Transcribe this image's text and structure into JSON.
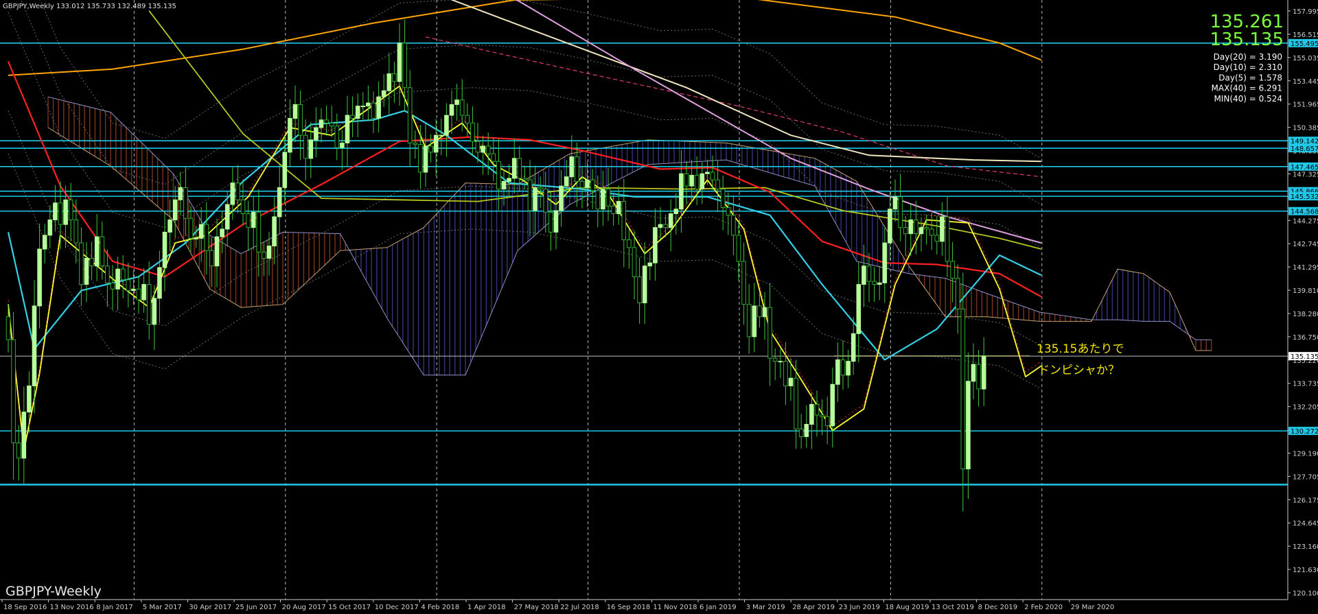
{
  "window": {
    "header": "GBPJPY,Weekly  133.012 135.733 132.489 135.135",
    "watermark": "GBPJPY-Weekly"
  },
  "price_box": {
    "bid": "135.261",
    "ask": "135.135",
    "stats": [
      "Day(20) = 3.190",
      "Day(10) = 2.310",
      "Day(5) = 1.578",
      "MAX(40) = 6.291",
      "MIN(40) = 0.524"
    ]
  },
  "annotation": {
    "line1": "135.15あたりで",
    "line2": "ドンピシャか？"
  },
  "colors": {
    "bull": "#b7ff9a",
    "bear": "#2fae2f",
    "hline": "#1ec8e6",
    "ma_fast": "#ffff33",
    "ma_mid": "#ff2020",
    "ma_cyan": "#33d0e8",
    "ma_long": "#ffa500",
    "ma_white": "#f0e6c0",
    "ma_violet": "#e0a0e0",
    "cloud_bull": "#8a3a20",
    "cloud_bear": "#3a3a8a"
  },
  "chart_data": {
    "type": "candlestick",
    "symbol": "GBPJPY",
    "timeframe": "Weekly",
    "ylim": [
      119.3,
      158.3
    ],
    "y_ticks": [
      "157.995",
      "156.515",
      "155.035",
      "153.445",
      "151.965",
      "150.385",
      "148.855",
      "147.325",
      "145.805",
      "144.275",
      "142.745",
      "141.295",
      "139.810",
      "138.280",
      "136.750",
      "135.220",
      "133.735",
      "132.205",
      "130.735",
      "129.190",
      "127.705",
      "126.175",
      "124.645",
      "123.160",
      "121.630",
      "120.100"
    ],
    "x_labels": [
      "18 Sep 2016",
      "13 Nov 2016",
      "8 Jan 2017",
      "5 Mar 2017",
      "30 Apr 2017",
      "25 Jun 2017",
      "20 Aug 2017",
      "15 Oct 2017",
      "10 Dec 2017",
      "4 Feb 2018",
      "1 Apr 2018",
      "27 May 2018",
      "22 Jul 2018",
      "16 Sep 2018",
      "11 Nov 2018",
      "6 Jan 2019",
      "3 Mar 2019",
      "28 Apr 2019",
      "23 Jun 2019",
      "18 Aug 2019",
      "13 Oct 2019",
      "8 Dec 2019",
      "2 Feb 2020",
      "29 Mar 2020"
    ],
    "hlines": [
      {
        "price": 155.495,
        "label": "155.495"
      },
      {
        "price": 149.142,
        "label": "149.142"
      },
      {
        "price": 148.657,
        "label": "148.657"
      },
      {
        "price": 147.465,
        "label": "147.465"
      },
      {
        "price": 145.866,
        "label": "145.866"
      },
      {
        "price": 145.532,
        "label": "145.532"
      },
      {
        "price": 144.568,
        "label": "144.568"
      },
      {
        "price": 130.272,
        "label": "130.272"
      },
      {
        "price": 126.78,
        "label": ""
      }
    ],
    "current_price": {
      "price": 135.135,
      "label": "135.135"
    },
    "closes": [
      136.2,
      129.5,
      128.5,
      131.5,
      133.2,
      138.4,
      142.1,
      143.0,
      144.0,
      145.1,
      143.7,
      145.3,
      144.0,
      142.5,
      139.8,
      141.5,
      141.0,
      142.9,
      141.0,
      139.9,
      139.5,
      140.8,
      140.1,
      139.4,
      139.5,
      138.8,
      139.8,
      137.2,
      138.9,
      140.9,
      143.2,
      144.0,
      145.3,
      146.1,
      144.1,
      142.8,
      142.8,
      143.7,
      142.0,
      141.0,
      142.9,
      143.4,
      145.0,
      146.4,
      145.3,
      144.4,
      143.5,
      144.5,
      141.9,
      141.5,
      142.3,
      144.2,
      146.1,
      148.4,
      150.6,
      151.5,
      149.5,
      148.0,
      149.2,
      150.0,
      150.5,
      150.3,
      150.1,
      148.7,
      149.0,
      150.8,
      150.6,
      151.4,
      151.4,
      151.6,
      150.6,
      152.0,
      152.4,
      153.5,
      153.0,
      155.5,
      152.6,
      149.0,
      148.9,
      147.1,
      148.8,
      148.4,
      149.5,
      149.5,
      150.8,
      151.5,
      151.8,
      150.8,
      150.3,
      149.1,
      148.4,
      148.8,
      148.3,
      147.8,
      146.0,
      146.5,
      146.7,
      148.0,
      146.7,
      146.6,
      144.6,
      146.1,
      146.0,
      144.5,
      143.2,
      144.6,
      146.2,
      146.8,
      148.1,
      146.5,
      146.1,
      146.6,
      145.9,
      144.7,
      146.0,
      144.9,
      144.4,
      145.2,
      142.7,
      142.2,
      140.3,
      138.6,
      141.0,
      141.2,
      143.5,
      143.7,
      143.5,
      144.4,
      144.7,
      147.0,
      146.2,
      146.9,
      146.0,
      147.0,
      147.1,
      146.6,
      146.0,
      144.8,
      144.3,
      143.0,
      141.3,
      138.5,
      136.4,
      138.4,
      137.7,
      138.3,
      135.0,
      134.8,
      134.8,
      133.2,
      133.7,
      130.4,
      129.9,
      130.7,
      132.0,
      131.3,
      131.2,
      130.6,
      133.3,
      134.9,
      133.9,
      134.8,
      136.6,
      139.8,
      141.0,
      140.0,
      139.8,
      139.9,
      142.5,
      144.7,
      145.5,
      143.5,
      143.1,
      144.0,
      143.1,
      143.5,
      143.4,
      143.0,
      142.6,
      144.2,
      141.3,
      140.2,
      138.2,
      127.8,
      133.5,
      134.6,
      133.0,
      135.135
    ],
    "ma_fast": [
      [
        0,
        138.5
      ],
      [
        3,
        129.0
      ],
      [
        6,
        134
      ],
      [
        10,
        143
      ],
      [
        16,
        141.3
      ],
      [
        22,
        139.6
      ],
      [
        27,
        138.3
      ],
      [
        32,
        142.5
      ],
      [
        38,
        143.0
      ],
      [
        46,
        145.5
      ],
      [
        54,
        150.0
      ],
      [
        62,
        149.5
      ],
      [
        75,
        152.7
      ],
      [
        80,
        148.7
      ],
      [
        87,
        150.3
      ],
      [
        93,
        147.6
      ],
      [
        99,
        146.5
      ],
      [
        105,
        145.0
      ],
      [
        110,
        146.8
      ],
      [
        115,
        145.7
      ],
      [
        122,
        141.8
      ],
      [
        127,
        143.3
      ],
      [
        134,
        146.6
      ],
      [
        141,
        143.4
      ],
      [
        146,
        136.8
      ],
      [
        152,
        133.6
      ],
      [
        158,
        130.3
      ],
      [
        164,
        131.7
      ],
      [
        170,
        139.8
      ],
      [
        176,
        144.0
      ],
      [
        184,
        143.8
      ],
      [
        190,
        139.5
      ],
      [
        195,
        133.8
      ],
      [
        198,
        134.5
      ]
    ],
    "ma_cyan": [
      [
        0,
        143.2
      ],
      [
        5,
        135.6
      ],
      [
        14,
        139.4
      ],
      [
        25,
        140.3
      ],
      [
        34,
        142.5
      ],
      [
        45,
        146.5
      ],
      [
        58,
        150.2
      ],
      [
        70,
        150.5
      ],
      [
        76,
        151.1
      ],
      [
        84,
        149.5
      ],
      [
        96,
        146.4
      ],
      [
        110,
        146.0
      ],
      [
        120,
        145.5
      ],
      [
        134,
        145.5
      ],
      [
        146,
        144.3
      ],
      [
        156,
        139.8
      ],
      [
        168,
        134.9
      ],
      [
        178,
        136.9
      ],
      [
        190,
        141.7
      ],
      [
        198,
        140.4
      ]
    ],
    "ma_mid": [
      [
        0,
        154.3
      ],
      [
        10,
        146.2
      ],
      [
        20,
        141.3
      ],
      [
        30,
        140.3
      ],
      [
        45,
        143.7
      ],
      [
        60,
        146.3
      ],
      [
        75,
        149.1
      ],
      [
        89,
        149.4
      ],
      [
        100,
        149.2
      ],
      [
        110,
        148.5
      ],
      [
        125,
        147.3
      ],
      [
        135,
        147.4
      ],
      [
        146,
        145.8
      ],
      [
        156,
        142.6
      ],
      [
        168,
        141.2
      ],
      [
        178,
        141.1
      ],
      [
        190,
        140.5
      ],
      [
        198,
        139.0
      ]
    ],
    "ma_olive": [
      [
        27,
        157.6
      ],
      [
        45,
        149.6
      ],
      [
        60,
        145.4
      ],
      [
        75,
        145.3
      ],
      [
        90,
        145.2
      ],
      [
        110,
        146.1
      ],
      [
        130,
        146.0
      ],
      [
        145,
        146.1
      ],
      [
        160,
        144.6
      ],
      [
        178,
        143.6
      ],
      [
        190,
        142.8
      ],
      [
        198,
        142.1
      ]
    ],
    "ma_long": [
      [
        0,
        153.4
      ],
      [
        20,
        153.8
      ],
      [
        45,
        155.1
      ],
      [
        70,
        156.8
      ],
      [
        97,
        158.3
      ],
      [
        140,
        158.5
      ],
      [
        170,
        157.2
      ],
      [
        190,
        155.5
      ],
      [
        198,
        154.4
      ]
    ],
    "ma_white": [
      [
        82,
        158.7
      ],
      [
        100,
        156.4
      ],
      [
        130,
        152.6
      ],
      [
        150,
        149.5
      ],
      [
        165,
        148.2
      ],
      [
        185,
        147.9
      ],
      [
        198,
        147.8
      ]
    ],
    "ma_violet": [
      [
        95,
        158.8
      ],
      [
        120,
        153.8
      ],
      [
        150,
        148.0
      ],
      [
        165,
        146.0
      ],
      [
        180,
        144.2
      ],
      [
        198,
        142.5
      ]
    ],
    "ma_dash": [
      [
        80,
        155.9
      ],
      [
        110,
        153.6
      ],
      [
        140,
        151.4
      ],
      [
        160,
        149.7
      ],
      [
        180,
        147.5
      ],
      [
        198,
        146.8
      ]
    ],
    "cloud_a": [
      [
        0,
        150.0
      ],
      [
        12,
        147.5
      ],
      [
        24,
        144.0
      ],
      [
        31,
        139.5
      ],
      [
        37,
        138.3
      ],
      [
        45,
        138.5
      ],
      [
        56,
        142.0
      ],
      [
        65,
        142.2
      ],
      [
        72,
        143.5
      ],
      [
        80,
        146.4
      ],
      [
        90,
        146.3
      ],
      [
        100,
        148.3
      ],
      [
        115,
        149.2
      ],
      [
        130,
        149.0
      ],
      [
        147,
        148.0
      ],
      [
        155,
        146.5
      ],
      [
        165,
        141.0
      ],
      [
        172,
        137.7
      ],
      [
        180,
        137.7
      ],
      [
        190,
        137.4
      ],
      [
        200,
        137.4
      ],
      [
        205,
        140.8
      ],
      [
        210,
        140.5
      ],
      [
        215,
        139.3
      ],
      [
        220,
        135.5
      ],
      [
        223,
        135.5
      ]
    ],
    "cloud_b": [
      [
        0,
        152.0
      ],
      [
        12,
        151.0
      ],
      [
        24,
        147.0
      ],
      [
        31,
        143.0
      ],
      [
        37,
        141.8
      ],
      [
        45,
        143.2
      ],
      [
        56,
        143.1
      ],
      [
        65,
        137.6
      ],
      [
        72,
        133.9
      ],
      [
        80,
        133.9
      ],
      [
        90,
        142.0
      ],
      [
        100,
        145.0
      ],
      [
        115,
        147.6
      ],
      [
        130,
        147.9
      ],
      [
        147,
        146.2
      ],
      [
        155,
        141.3
      ],
      [
        165,
        140.5
      ],
      [
        172,
        140.2
      ],
      [
        180,
        139.2
      ],
      [
        190,
        138.0
      ],
      [
        200,
        137.5
      ],
      [
        205,
        137.5
      ],
      [
        210,
        137.4
      ],
      [
        215,
        137.4
      ],
      [
        220,
        136.2
      ],
      [
        223,
        136.2
      ]
    ]
  }
}
